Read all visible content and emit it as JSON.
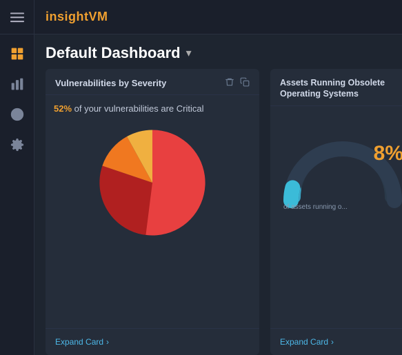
{
  "app": {
    "title_prefix": "insight",
    "title_suffix": "VM"
  },
  "sidebar": {
    "items": [
      {
        "label": "Menu",
        "icon": "menu",
        "active": false
      },
      {
        "label": "Dashboard",
        "icon": "grid",
        "active": true
      },
      {
        "label": "Reports",
        "icon": "bar-chart",
        "active": false
      },
      {
        "label": "Compliance",
        "icon": "check-circle",
        "active": false
      },
      {
        "label": "Settings",
        "icon": "settings",
        "active": false
      }
    ]
  },
  "dashboard": {
    "title": "Default Dashboard",
    "dropdown_label": "▾"
  },
  "cards": [
    {
      "id": "vuln-by-severity",
      "title": "Vulnerabilities by Severity",
      "stat_percent": "52%",
      "stat_label": " of your vulnerabilities are Critical",
      "expand_label": "Expand Card",
      "pie": {
        "critical_pct": 52,
        "high_pct": 28,
        "medium_pct": 12,
        "low_pct": 8
      }
    },
    {
      "id": "assets-obsolete-os",
      "title": "Assets Running Obsolete Operating Systems",
      "percent": "8%",
      "stat_label": "of assets running o...",
      "expand_label": "Expand Card"
    }
  ],
  "icons": {
    "trash": "🗑",
    "copy": "⧉",
    "chevron_right": "›"
  }
}
